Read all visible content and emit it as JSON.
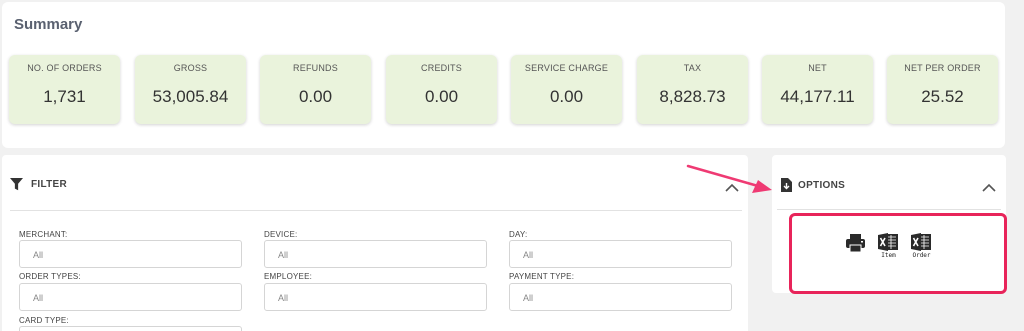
{
  "summary": {
    "title": "Summary",
    "stats": [
      {
        "label": "NO. OF ORDERS",
        "value": "1,731"
      },
      {
        "label": "GROSS",
        "value": "53,005.84"
      },
      {
        "label": "REFUNDS",
        "value": "0.00"
      },
      {
        "label": "CREDITS",
        "value": "0.00"
      },
      {
        "label": "SERVICE CHARGE",
        "value": "0.00"
      },
      {
        "label": "TAX",
        "value": "8,828.73"
      },
      {
        "label": "NET",
        "value": "44,177.11"
      },
      {
        "label": "NET PER ORDER",
        "value": "25.52"
      }
    ]
  },
  "filter": {
    "title": "FILTER",
    "icon": "filter-icon",
    "fields": {
      "merchant": {
        "label": "MERCHANT:",
        "value": "All"
      },
      "device": {
        "label": "DEVICE:",
        "value": "All"
      },
      "day": {
        "label": "DAY:",
        "value": "All"
      },
      "order_types": {
        "label": "ORDER TYPES:",
        "value": "All"
      },
      "employee": {
        "label": "EMPLOYEE:",
        "value": "All"
      },
      "payment_type": {
        "label": "PAYMENT TYPE:",
        "value": "All"
      },
      "card_type": {
        "label": "CARD TYPE:"
      }
    }
  },
  "options": {
    "title": "OPTIONS",
    "icon": "download-file-icon",
    "buttons": [
      {
        "name": "print",
        "icon": "printer-icon",
        "caption": ""
      },
      {
        "name": "excel-item",
        "icon": "excel-icon",
        "caption": "Item"
      },
      {
        "name": "excel-order",
        "icon": "excel-icon",
        "caption": "Order"
      }
    ]
  },
  "colors": {
    "stat_bg": "#eaf3dc",
    "highlight": "#e8245a",
    "arrow": "#ef3a73"
  }
}
